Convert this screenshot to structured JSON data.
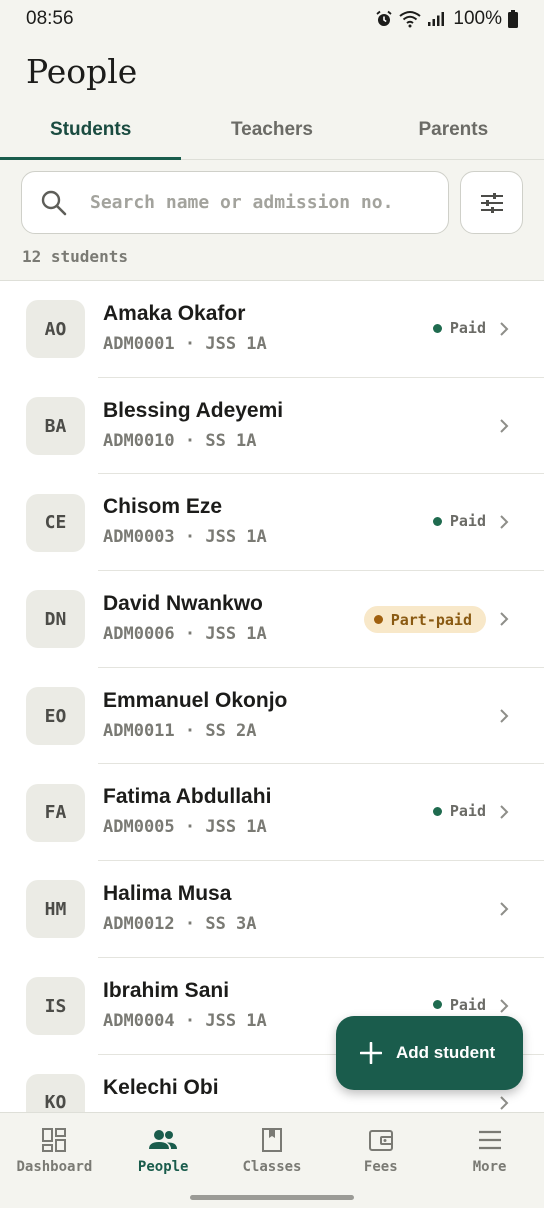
{
  "status_bar": {
    "time": "08:56",
    "battery": "100%"
  },
  "page": {
    "title": "People"
  },
  "tabs": [
    {
      "label": "Students",
      "active": true
    },
    {
      "label": "Teachers",
      "active": false
    },
    {
      "label": "Parents",
      "active": false
    }
  ],
  "search": {
    "placeholder": "Search name or admission no.",
    "value": ""
  },
  "count_label": "12 students",
  "students": [
    {
      "initials": "AO",
      "name": "Amaka Okafor",
      "sub": "ADM0001 · JSS 1A",
      "status": "Paid"
    },
    {
      "initials": "BA",
      "name": "Blessing Adeyemi",
      "sub": "ADM0010 · SS 1A",
      "status": ""
    },
    {
      "initials": "CE",
      "name": "Chisom Eze",
      "sub": "ADM0003 · JSS 1A",
      "status": "Paid"
    },
    {
      "initials": "DN",
      "name": "David Nwankwo",
      "sub": "ADM0006 · JSS 1A",
      "status": "Part-paid"
    },
    {
      "initials": "EO",
      "name": "Emmanuel Okonjo",
      "sub": "ADM0011 · SS 2A",
      "status": ""
    },
    {
      "initials": "FA",
      "name": "Fatima Abdullahi",
      "sub": "ADM0005 · JSS 1A",
      "status": "Paid"
    },
    {
      "initials": "HM",
      "name": "Halima Musa",
      "sub": "ADM0012 · SS 3A",
      "status": ""
    },
    {
      "initials": "IS",
      "name": "Ibrahim Sani",
      "sub": "ADM0004 · JSS 1A",
      "status": "Paid"
    },
    {
      "initials": "KO",
      "name": "Kelechi Obi",
      "sub": "",
      "status": ""
    }
  ],
  "fab": {
    "label": "Add student",
    "icon": "plus-icon"
  },
  "bottom_nav": [
    {
      "label": "Dashboard",
      "icon": "dashboard-icon",
      "active": false
    },
    {
      "label": "People",
      "icon": "people-icon",
      "active": true
    },
    {
      "label": "Classes",
      "icon": "book-icon",
      "active": false
    },
    {
      "label": "Fees",
      "icon": "wallet-icon",
      "active": false
    },
    {
      "label": "More",
      "icon": "menu-icon",
      "active": false
    }
  ],
  "colors": {
    "accent": "#1a5c4c",
    "paid_dot": "#1f6b4f",
    "part_paid_bg": "#f8e8c9",
    "part_paid_dot": "#a0600e"
  }
}
